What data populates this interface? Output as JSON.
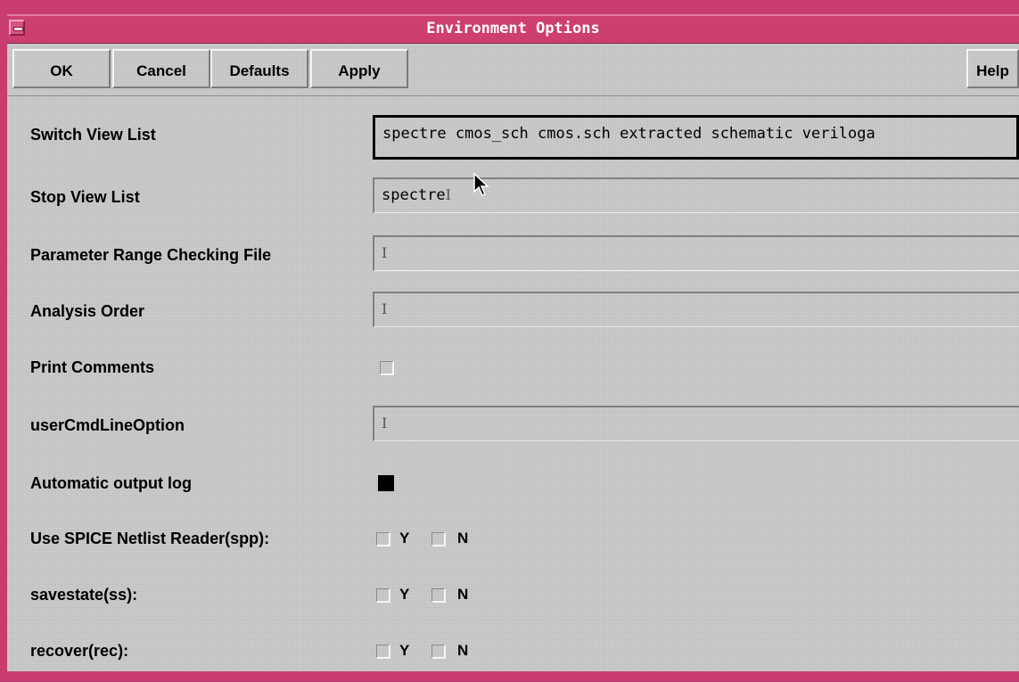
{
  "window": {
    "title": "Environment Options"
  },
  "toolbar": {
    "ok": "OK",
    "cancel": "Cancel",
    "defaults": "Defaults",
    "apply": "Apply",
    "help": "Help"
  },
  "fields": {
    "switch_view_list": {
      "label": "Switch View List",
      "value": "spectre cmos_sch cmos.sch extracted schematic veriloga"
    },
    "stop_view_list": {
      "label": "Stop View List",
      "value": "spectre"
    },
    "param_range_file": {
      "label": "Parameter Range Checking File",
      "value": ""
    },
    "analysis_order": {
      "label": "Analysis Order",
      "value": ""
    },
    "print_comments": {
      "label": "Print Comments",
      "checked": false
    },
    "user_cmd_line": {
      "label": "userCmdLineOption",
      "value": ""
    },
    "auto_output_log": {
      "label": "Automatic output log",
      "checked": true
    },
    "spice_reader": {
      "label": "Use SPICE Netlist Reader(spp):",
      "y": "Y",
      "n": "N"
    },
    "savestate": {
      "label": "savestate(ss):",
      "y": "Y",
      "n": "N"
    },
    "recover": {
      "label": "recover(rec):",
      "y": "Y",
      "n": "N"
    }
  }
}
